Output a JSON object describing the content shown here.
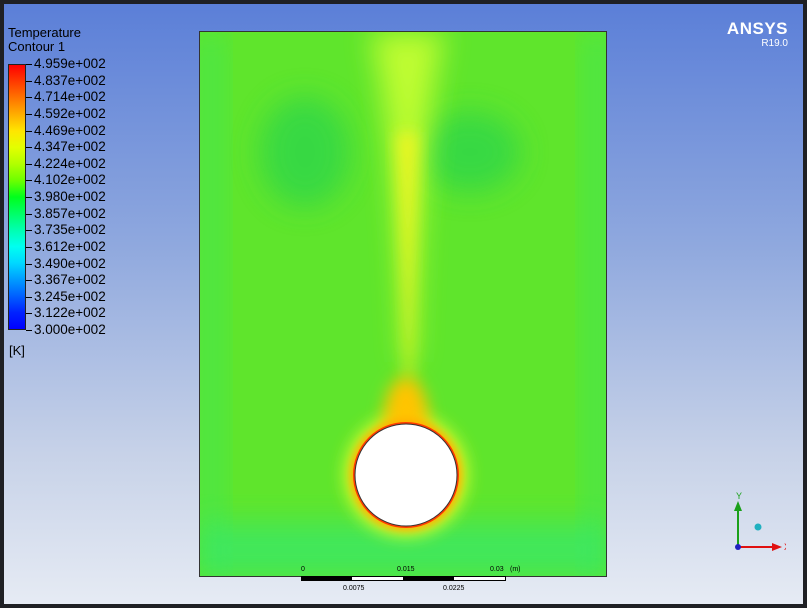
{
  "legend": {
    "title": "Temperature",
    "subtitle": "Contour 1",
    "unit": "[K]",
    "labels": [
      "4.959e+002",
      "4.837e+002",
      "4.714e+002",
      "4.592e+002",
      "4.469e+002",
      "4.347e+002",
      "4.224e+002",
      "4.102e+002",
      "3.980e+002",
      "3.857e+002",
      "3.735e+002",
      "3.612e+002",
      "3.490e+002",
      "3.367e+002",
      "3.245e+002",
      "3.122e+002",
      "3.000e+002"
    ],
    "colors": [
      "#ff0000",
      "#ff3a00",
      "#ff7400",
      "#ffae00",
      "#ffe600",
      "#e3ff00",
      "#b1ff00",
      "#6dff00",
      "#00ff1c",
      "#00ff66",
      "#00ffb0",
      "#00fff0",
      "#00d8ff",
      "#009cff",
      "#0060ff",
      "#0022ff",
      "#0000ff"
    ]
  },
  "brand": {
    "name": "ANSYS",
    "version": "R19.0"
  },
  "scale_bar": {
    "top_labels": [
      "0",
      "0.015",
      "0.03",
      "(m)"
    ],
    "bottom_labels": [
      "0.0075",
      "0.0225"
    ]
  },
  "axes": {
    "y": "Y",
    "x": "X"
  }
}
